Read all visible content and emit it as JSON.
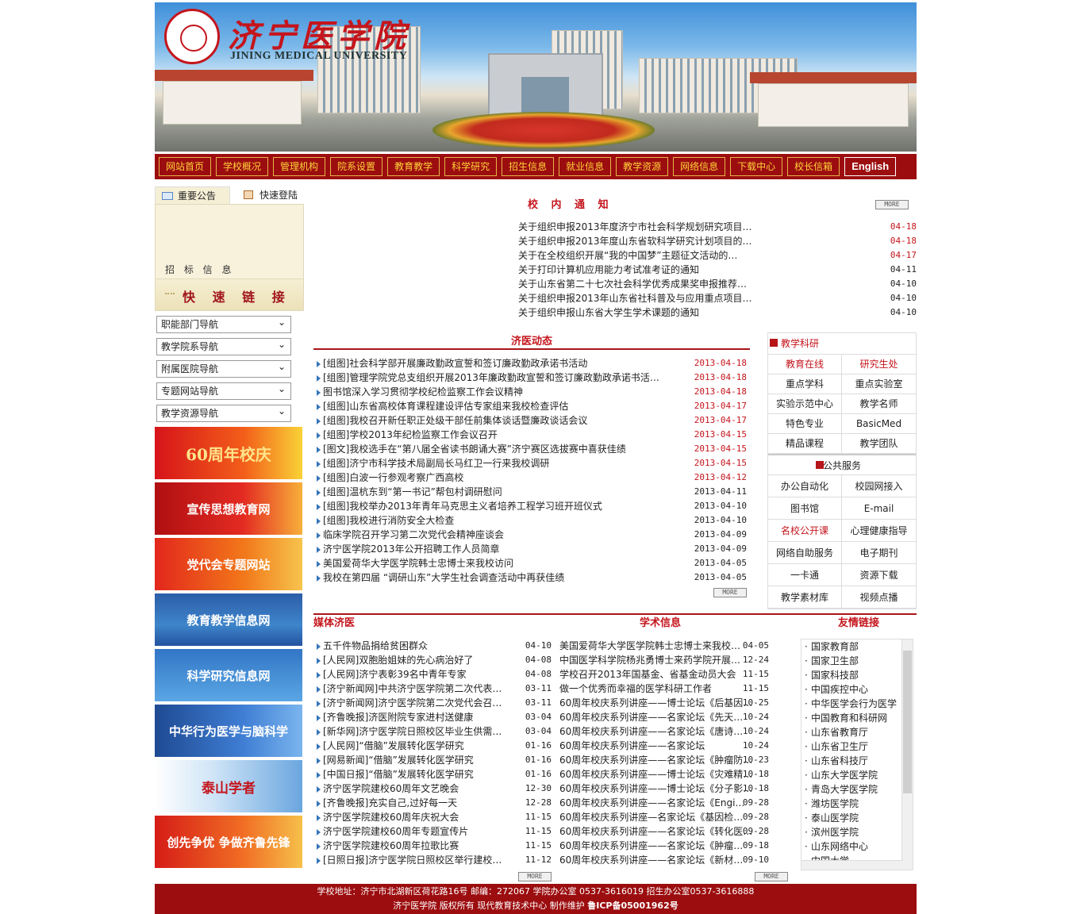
{
  "header": {
    "logo_cn": "济宁医学院",
    "logo_en": "JINING MEDICAL UNIVERSITY"
  },
  "nav": [
    "网站首页",
    "学校概况",
    "管理机构",
    "院系设置",
    "教育教学",
    "科学研究",
    "招生信息",
    "就业信息",
    "教学资源",
    "网络信息",
    "下载中心",
    "校长信箱",
    "English"
  ],
  "left": {
    "tab1": "重要公告",
    "tab2": "快速登陆",
    "zhaobiao": "招 标 信 息",
    "quick_links": "快 速 链 接",
    "selects": [
      "职能部门导航",
      "教学院系导航",
      "附属医院导航",
      "专题网站导航",
      "教学资源导航"
    ],
    "banners": [
      "60周年校庆",
      "宣传思想教育网",
      "党代会专题网站",
      "教育教学信息网",
      "科学研究信息网",
      "中华行为医学与脑科学",
      "泰山学者",
      "创先争优 争做齐鲁先锋"
    ]
  },
  "notice": {
    "title": "校 内 通 知",
    "more": "MORE",
    "items": [
      {
        "t": "关于组织申报2013年度济宁市社会科学规划研究项目…",
        "d": "04-18",
        "red": true
      },
      {
        "t": "关于组织申报2013年度山东省软科学研究计划项目的…",
        "d": "04-18",
        "red": true
      },
      {
        "t": "关于在全校组织开展“我的中国梦”主题征文活动的…",
        "d": "04-17",
        "red": true
      },
      {
        "t": "关于打印计算机应用能力考试准考证的通知",
        "d": "04-11",
        "red": false
      },
      {
        "t": "关于山东省第二十七次社会科学优秀成果奖申报推荐…",
        "d": "04-10",
        "red": false
      },
      {
        "t": "关于组织申报2013年山东省社科普及与应用重点项目…",
        "d": "04-10",
        "red": false
      },
      {
        "t": "关于组织申报山东省大学生学术课题的通知",
        "d": "04-10",
        "red": false
      }
    ]
  },
  "news": {
    "title": "济医动态",
    "items": [
      {
        "t": "[组图]社会科学部开展廉政勤政宣誓和签订廉政勤政承诺书活动",
        "d": "2013-04-18",
        "red": true
      },
      {
        "t": "[组图]管理学院党总支组织开展2013年廉政勤政宣誓和签订廉政勤政承诺书活…",
        "d": "2013-04-18",
        "red": true
      },
      {
        "t": "图书馆深入学习贯彻学校纪检监察工作会议精神",
        "d": "2013-04-18",
        "red": true
      },
      {
        "t": "[组图]山东省高校体育课程建设评估专家组来我校检查评估",
        "d": "2013-04-17",
        "red": true
      },
      {
        "t": "[组图]我校召开新任职正处级干部任前集体谈话暨廉政谈话会议",
        "d": "2013-04-17",
        "red": true
      },
      {
        "t": "[组图]学校2013年纪检监察工作会议召开",
        "d": "2013-04-15",
        "red": true
      },
      {
        "t": "[图文]我校选手在“第八届全省读书朗诵大赛”济宁赛区选拔赛中喜获佳绩",
        "d": "2013-04-15",
        "red": true
      },
      {
        "t": "[组图]济宁市科学技术局副局长马红卫一行来我校调研",
        "d": "2013-04-15",
        "red": true
      },
      {
        "t": "[组图]白波一行参观考察广西高校",
        "d": "2013-04-12",
        "red": true
      },
      {
        "t": "[组图]温杭东到“第一书记”帮包村调研慰问",
        "d": "2013-04-11",
        "red": false
      },
      {
        "t": "[组图]我校举办2013年青年马克思主义者培养工程学习班开班仪式",
        "d": "2013-04-10",
        "red": false
      },
      {
        "t": "[组图]我校进行消防安全大检查",
        "d": "2013-04-10",
        "red": false
      },
      {
        "t": "临床学院召开学习第二次党代会精神座谈会",
        "d": "2013-04-09",
        "red": false
      },
      {
        "t": "济宁医学院2013年公开招聘工作人员简章",
        "d": "2013-04-09",
        "red": false
      },
      {
        "t": "美国爱荷华大学医学院韩士忠博士来我校访问",
        "d": "2013-04-05",
        "red": false
      },
      {
        "t": "我校在第四届 “调研山东”大学生社会调查活动中再获佳绩",
        "d": "2013-04-05",
        "red": false
      }
    ]
  },
  "side": {
    "title1": "教学科研",
    "grid1": [
      {
        "t": "教育在线",
        "red": true
      },
      {
        "t": "研究生处",
        "red": true
      },
      {
        "t": "重点学科",
        "red": false
      },
      {
        "t": "重点实验室",
        "red": false
      },
      {
        "t": "实验示范中心",
        "red": false
      },
      {
        "t": "教学名师",
        "red": false
      },
      {
        "t": "特色专业",
        "red": false
      },
      {
        "t": "BasicMed",
        "red": false
      },
      {
        "t": "精品课程",
        "red": false
      },
      {
        "t": "教学团队",
        "red": false
      }
    ],
    "title2": "公共服务",
    "grid2": [
      {
        "t": "办公自动化",
        "red": false
      },
      {
        "t": "校园网接入",
        "red": false
      },
      {
        "t": "图书馆",
        "red": false
      },
      {
        "t": "E-mail",
        "red": false
      },
      {
        "t": "名校公开课",
        "red": true
      },
      {
        "t": "心理健康指导",
        "red": false
      },
      {
        "t": "网络自助服务",
        "red": false
      },
      {
        "t": "电子期刊",
        "red": false
      },
      {
        "t": "一卡通",
        "red": false
      },
      {
        "t": "资源下载",
        "red": false
      },
      {
        "t": "教学素材库",
        "red": false
      },
      {
        "t": "视频点播",
        "red": false
      }
    ]
  },
  "media": {
    "title": "媒体济医",
    "items": [
      {
        "t": "五千件物品捐给贫困群众",
        "d": "04-10"
      },
      {
        "t": "[人民网]双胞胎姐妹的先心病治好了",
        "d": "04-08"
      },
      {
        "t": "[人民网]济宁表彰39名中青年专家",
        "d": "04-08"
      },
      {
        "t": "[济宁新闻网]中共济宁医学院第二次代表…",
        "d": "03-11"
      },
      {
        "t": "[济宁新闻网]济宁医学院第二次党代会召…",
        "d": "03-11"
      },
      {
        "t": "[齐鲁晚报]济医附院专家进村送健康",
        "d": "03-04"
      },
      {
        "t": "[新华网]济宁医学院日照校区毕业生供需…",
        "d": "03-04"
      },
      {
        "t": "[人民网]“借脑”发展转化医学研究",
        "d": "01-16"
      },
      {
        "t": "[网易新闻]“借脑”发展转化医学研究",
        "d": "01-16"
      },
      {
        "t": "[中国日报]“借脑”发展转化医学研究",
        "d": "01-16"
      },
      {
        "t": "济宁医学院建校60周年文艺晚会",
        "d": "12-30"
      },
      {
        "t": "[齐鲁晚报]充实自己,过好每一天",
        "d": "12-28"
      },
      {
        "t": "济宁医学院建校60周年庆祝大会",
        "d": "11-15"
      },
      {
        "t": "济宁医学院建校60周年专题宣传片",
        "d": "11-15"
      },
      {
        "t": "济宁医学院建校60周年拉歌比赛",
        "d": "11-15"
      },
      {
        "t": "[日照日报]济宁医学院日照校区举行建校…",
        "d": "11-12"
      }
    ]
  },
  "academic": {
    "title": "学术信息",
    "items": [
      {
        "t": "美国爱荷华大学医学院韩士忠博士来我校…",
        "d": "04-05"
      },
      {
        "t": "中国医学科学院杨兆勇博士来药学院开展…",
        "d": "12-24"
      },
      {
        "t": "学校召开2013年国基金、省基金动员大会",
        "d": "11-15"
      },
      {
        "t": "做一个优秀而幸福的医学科研工作者",
        "d": "11-15"
      },
      {
        "t": "60周年校庆系列讲座——博士论坛《后基因…",
        "d": "10-25"
      },
      {
        "t": "60周年校庆系列讲座——名家论坛《先天…",
        "d": "10-24"
      },
      {
        "t": "60周年校庆系列讲座——名家论坛《唐诗…",
        "d": "10-24"
      },
      {
        "t": "60周年校庆系列讲座——名家论坛",
        "d": "10-24"
      },
      {
        "t": "60周年校庆系列讲座——名家论坛《肿瘤防…",
        "d": "10-23"
      },
      {
        "t": "60周年校庆系列讲座——博士论坛《灾难精…",
        "d": "10-18"
      },
      {
        "t": "60周年校庆系列讲座——博士论坛《分子影…",
        "d": "10-18"
      },
      {
        "t": "60周年校庆系列讲座——名家论坛《Engi…",
        "d": "09-28"
      },
      {
        "t": "60周年校庆系列讲座—名家论坛《基因检…",
        "d": "09-28"
      },
      {
        "t": "60周年校庆系列讲座——名家论坛《转化医…",
        "d": "09-28"
      },
      {
        "t": "60周年校庆系列讲座——名家论坛《肿瘤…",
        "d": "09-18"
      },
      {
        "t": "60周年校庆系列讲座——名家论坛《新材…",
        "d": "09-10"
      }
    ]
  },
  "friends": {
    "title": "友情链接",
    "items": [
      "国家教育部",
      "国家卫生部",
      "国家科技部",
      "中国疾控中心",
      "中华医学会行为医学",
      "中国教育和科研网",
      "山东省教育厅",
      "山东省卫生厅",
      "山东省科技厅",
      "山东大学医学院",
      "青岛大学医学院",
      "潍坊医学院",
      "泰山医学院",
      "滨州医学院",
      "山东网络中心",
      "中国大学"
    ]
  },
  "footer": {
    "line1": "学校地址：济宁市北湖新区荷花路16号 邮编：272067 学院办公室 0537-3616019 招生办公室0537-3616888",
    "line2": "济宁医学院 版权所有 现代教育技术中心 制作维护",
    "icp": "鲁ICP备05001962号"
  }
}
